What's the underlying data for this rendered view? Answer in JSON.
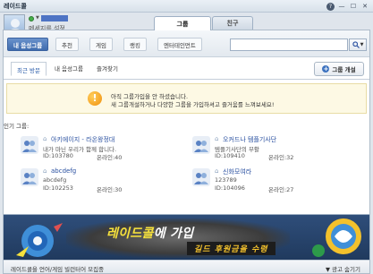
{
  "window": {
    "title": "레이드콜",
    "controls": {
      "help": "?",
      "minimize": "—",
      "maximize": "☐",
      "close": "✕"
    }
  },
  "profile": {
    "status_message": "메세지를 설정"
  },
  "main_tabs": [
    {
      "label": "그룹",
      "active": true
    },
    {
      "label": "친구",
      "active": false
    }
  ],
  "subnav": {
    "items": [
      {
        "label": "내 음성그룹",
        "active": true
      },
      {
        "label": "추천",
        "active": false
      },
      {
        "label": "게임",
        "active": false
      },
      {
        "label": "랭킹",
        "active": false
      },
      {
        "label": "엔터테인먼트",
        "active": false
      }
    ],
    "search_placeholder": "",
    "search_icon": "search-icon"
  },
  "tabs": [
    {
      "label": "최근 방문",
      "active": true
    },
    {
      "label": "내 음성그룹",
      "active": false
    },
    {
      "label": "즐겨찾기",
      "active": false
    }
  ],
  "create_button": {
    "label": "그룹 개설",
    "icon": "plus-circle-icon"
  },
  "notice": {
    "line1": "아직 그룹가입을 안 하셨습니다.",
    "line2": "새 그룹개설하거나 다양한 그룹을 가입하셔고 즐거움를 느껴보세요!",
    "icon": "warning-icon"
  },
  "section_label": "인기 그룹:",
  "groups": [
    {
      "name": "아키에이지 - 라온왕정대",
      "desc": "내가 마닌 우리가 함께 합니다.",
      "id": "ID:103780",
      "online": "온라인:40"
    },
    {
      "name": "오커드나 템플기사단",
      "desc": "템플기사단의 부활",
      "id": "ID:109410",
      "online": "온라인:32"
    },
    {
      "name": "abcdefg",
      "desc": "abcdefg",
      "id": "ID:102253",
      "online": "온라인:30"
    },
    {
      "name": "신화모여라",
      "desc": "123789",
      "id": "ID:104096",
      "online": "온라인:27"
    }
  ],
  "banner": {
    "brand": "레이드콜",
    "line1_rest": "에 가입",
    "line2": "길드 후원금을 수령"
  },
  "footer": {
    "text": "레이드콜을 언어/게임 빌런터어 모집중",
    "ad_close": "▼ 광고 숨기기"
  },
  "colors": {
    "accent": "#3f6cae",
    "link": "#2a50a0",
    "warning": "#f08f0c",
    "banner_highlight": "#f7e23c"
  }
}
